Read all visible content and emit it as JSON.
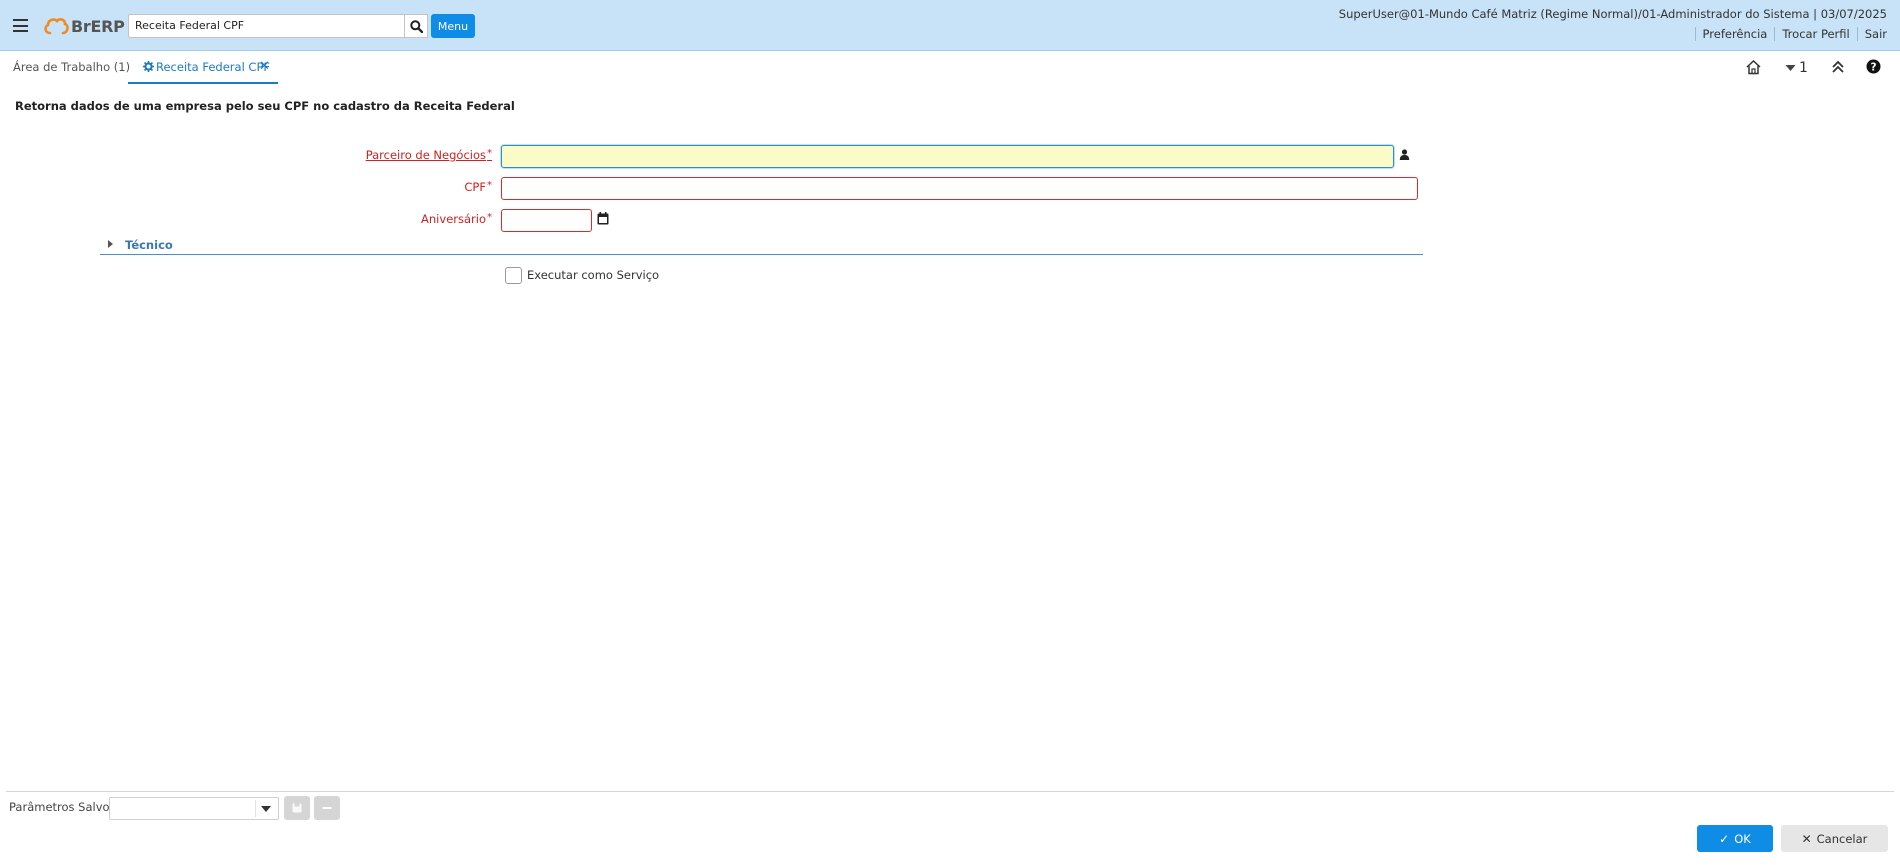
{
  "header": {
    "logo_text": "BrERP",
    "search_value": "Receita Federal CPF",
    "menu_label": "Menu",
    "user_info": "SuperUser@01-Mundo Café Matriz (Regime Normal)/01-Administrador do Sistema | 03/07/2025",
    "links": [
      "Preferência",
      "Trocar Perfil",
      "Sair"
    ]
  },
  "tabs": {
    "home_label": "Área de Trabalho (1)",
    "active_label": "Receita Federal CPF"
  },
  "toolbar": {
    "counter": "1"
  },
  "form": {
    "description": "Retorna dados de uma empresa pelo seu CPF no cadastro da Receita Federal",
    "fields": {
      "bpartner_label": "Parceiro de Negócios",
      "cpf_label": "CPF",
      "birthday_label": "Aniversário",
      "required_mark": "*"
    },
    "group_label": "Técnico",
    "checkbox_label": "Executar como Serviço"
  },
  "footer": {
    "saved_params_label": "Parâmetros Salvos",
    "ok_label": "OK",
    "cancel_label": "Cancelar"
  },
  "colors": {
    "header_bg": "#c8e3f7",
    "accent": "#0f8ce6",
    "required": "#d21f1f",
    "focus_bg": "#fbfbc8"
  }
}
